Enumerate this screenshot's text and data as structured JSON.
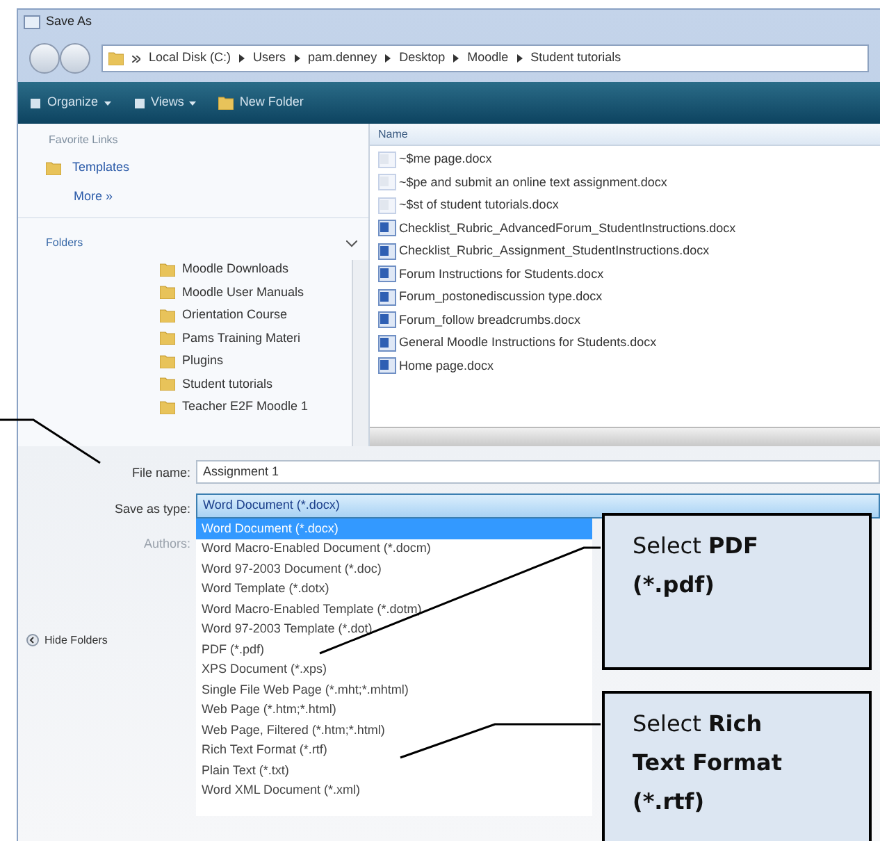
{
  "window": {
    "title": "Save As"
  },
  "address": {
    "crumbs": [
      "Local Disk (C:)",
      "Users",
      "pam.denney",
      "Desktop",
      "Moodle",
      "Student tutorials"
    ]
  },
  "toolbar": {
    "buttons": [
      {
        "label": "Organize",
        "kind": "menu"
      },
      {
        "label": "Views",
        "kind": "menu"
      },
      {
        "label": "New Folder",
        "kind": "folder"
      }
    ]
  },
  "sidebar": {
    "favorites_heading": "Favorite Links",
    "favorites": [
      "Templates"
    ],
    "more": "More »",
    "folders_heading": "Folders",
    "folders": [
      "Moodle Downloads",
      "Moodle User Manuals",
      "Orientation Course",
      "Pams Training Materi",
      "Plugins",
      "Student tutorials",
      "Teacher E2F Moodle 1"
    ]
  },
  "file_list": {
    "column": "Name",
    "files": [
      {
        "name": "~$me page.docx",
        "hidden": true
      },
      {
        "name": "~$pe and submit an online text assignment.docx",
        "hidden": true
      },
      {
        "name": "~$st of student tutorials.docx",
        "hidden": true
      },
      {
        "name": "Checklist_Rubric_AdvancedForum_StudentInstructions.docx",
        "hidden": false
      },
      {
        "name": "Checklist_Rubric_Assignment_StudentInstructions.docx",
        "hidden": false
      },
      {
        "name": "Forum Instructions for Students.docx",
        "hidden": false
      },
      {
        "name": "Forum_postonediscussion type.docx",
        "hidden": false
      },
      {
        "name": "Forum_follow breadcrumbs.docx",
        "hidden": false
      },
      {
        "name": "General Moodle Instructions for Students.docx",
        "hidden": false
      },
      {
        "name": "Home page.docx",
        "hidden": false
      }
    ]
  },
  "form": {
    "file_name_label": "File name:",
    "file_name": "Assignment 1",
    "type_label": "Save as type:",
    "type_value": "Word Document (*.docx)",
    "authors_label": "Authors:",
    "hide_folders": "Hide Folders"
  },
  "type_list": [
    {
      "label": "Word Document (*.docx)",
      "selected": true
    },
    {
      "label": "Word Macro-Enabled Document (*.docm)",
      "selected": false
    },
    {
      "label": "Word 97-2003 Document (*.doc)",
      "selected": false
    },
    {
      "label": "Word Template (*.dotx)",
      "selected": false
    },
    {
      "label": "Word Macro-Enabled Template (*.dotm)",
      "selected": false
    },
    {
      "label": "Word 97-2003 Template (*.dot)",
      "selected": false
    },
    {
      "label": "PDF (*.pdf)",
      "selected": false
    },
    {
      "label": "XPS Document (*.xps)",
      "selected": false
    },
    {
      "label": "Single File Web Page (*.mht;*.mhtml)",
      "selected": false
    },
    {
      "label": "Web Page (*.htm;*.html)",
      "selected": false
    },
    {
      "label": "Web Page, Filtered (*.htm;*.html)",
      "selected": false
    },
    {
      "label": "Rich Text Format (*.rtf)",
      "selected": false
    },
    {
      "label": "Plain Text (*.txt)",
      "selected": false
    },
    {
      "label": "Word XML Document (*.xml)",
      "selected": false
    }
  ],
  "callouts": [
    {
      "text": "Select",
      "bold": "PDF (*.pdf)"
    },
    {
      "text": "Select",
      "bold": "Rich Text Format (*.rtf)"
    }
  ]
}
